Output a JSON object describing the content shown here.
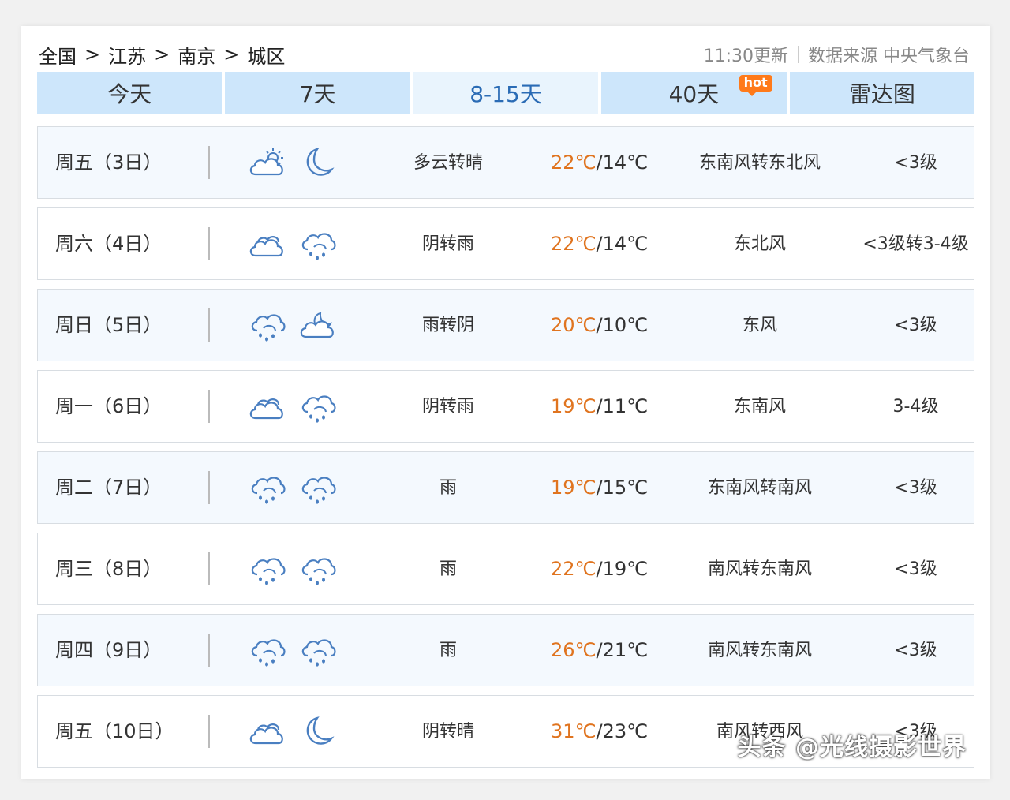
{
  "breadcrumb": {
    "items": [
      "全国",
      "江苏",
      "南京",
      "城区"
    ],
    "separator": ">"
  },
  "update": {
    "time_text": "11:30更新",
    "source_text": "数据来源 中央气象台"
  },
  "tabs": [
    {
      "label": "今天",
      "active": false
    },
    {
      "label": "7天",
      "active": false
    },
    {
      "label": "8-15天",
      "active": true
    },
    {
      "label": "40天",
      "active": false,
      "badge": "hot"
    },
    {
      "label": "雷达图",
      "active": false
    }
  ],
  "colors": {
    "tab_bg": "#cde6fb",
    "tab_active_bg": "#e9f4fd",
    "tab_active_text": "#2a6bb5",
    "high_temp": "#e0741f",
    "hot_badge": "#ff7a1a",
    "icon": "#4a7fc1"
  },
  "forecast": [
    {
      "day": "周五（3日）",
      "icon_day": "partly-cloudy-sun-icon",
      "icon_night": "moon-icon",
      "weather": "多云转晴",
      "high": "22℃",
      "low": "14℃",
      "wind": "东南风转东北风",
      "level": "<3级"
    },
    {
      "day": "周六（4日）",
      "icon_day": "overcast-cloud-icon",
      "icon_night": "rain-cloud-icon",
      "weather": "阴转雨",
      "high": "22℃",
      "low": "14℃",
      "wind": "东北风",
      "level": "<3级转3-4级"
    },
    {
      "day": "周日（5日）",
      "icon_day": "rain-cloud-icon",
      "icon_night": "cloud-moon-icon",
      "weather": "雨转阴",
      "high": "20℃",
      "low": "10℃",
      "wind": "东风",
      "level": "<3级"
    },
    {
      "day": "周一（6日）",
      "icon_day": "overcast-cloud-icon",
      "icon_night": "rain-cloud-icon",
      "weather": "阴转雨",
      "high": "19℃",
      "low": "11℃",
      "wind": "东南风",
      "level": "3-4级"
    },
    {
      "day": "周二（7日）",
      "icon_day": "rain-cloud-icon",
      "icon_night": "rain-cloud-icon",
      "weather": "雨",
      "high": "19℃",
      "low": "15℃",
      "wind": "东南风转南风",
      "level": "<3级"
    },
    {
      "day": "周三（8日）",
      "icon_day": "rain-cloud-icon",
      "icon_night": "rain-cloud-icon",
      "weather": "雨",
      "high": "22℃",
      "low": "19℃",
      "wind": "南风转东南风",
      "level": "<3级"
    },
    {
      "day": "周四（9日）",
      "icon_day": "rain-cloud-icon",
      "icon_night": "rain-cloud-icon",
      "weather": "雨",
      "high": "26℃",
      "low": "21℃",
      "wind": "南风转东南风",
      "level": "<3级"
    },
    {
      "day": "周五（10日）",
      "icon_day": "overcast-cloud-icon",
      "icon_night": "moon-icon",
      "weather": "阴转晴",
      "high": "31℃",
      "low": "23℃",
      "wind": "南风转西风",
      "level": "<3级"
    }
  ],
  "watermark": "头条 @光线摄影世界"
}
